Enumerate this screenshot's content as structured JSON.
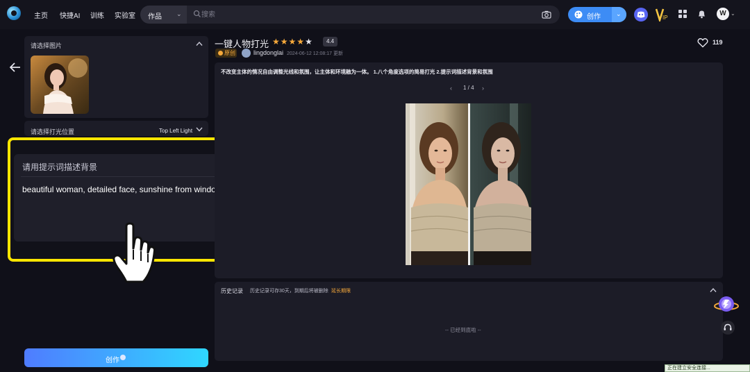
{
  "nav": {
    "items": [
      "主页",
      "快捷AI",
      "训练",
      "实验室"
    ],
    "search_category": "作品",
    "search_placeholder": "搜索",
    "create_label": "创作",
    "avatar_letter": "W"
  },
  "left": {
    "image_section_title": "请选择图片",
    "light_position_label": "请选择打光位置",
    "light_position_value": "Top Left Light",
    "prompt_section_title": "请用提示词描述背景",
    "prompt_text": "beautiful woman, detailed face, sunshine from window",
    "create_button_label": "创作"
  },
  "work": {
    "title": "一键人物打光",
    "stars": "★★★★★",
    "rating": "4.4",
    "original_badge": "原创",
    "author": "lingdonglai",
    "update_time": "2024-06-12 12:08:17 更新",
    "likes": "119",
    "description": "不改变主体的情况自由调整光线和氛围，让主体和环境融为一体。 1.八个角度选项的简易打光 2.提示词描述背景和氛围",
    "pager": "1 / 4"
  },
  "history": {
    "title": "历史记录",
    "note": "历史记录可存30天，到期后将被删除",
    "extend_link": "延长期限",
    "end_text": "-- 已经到底啦 --"
  },
  "status_bar": "正在建立安全连接...",
  "colors": {
    "accent_blue": "#3d8cf5",
    "highlight_yellow": "#ffe600",
    "star_orange": "#f6a93b",
    "background": "#101019",
    "panel": "#1c1c27"
  }
}
